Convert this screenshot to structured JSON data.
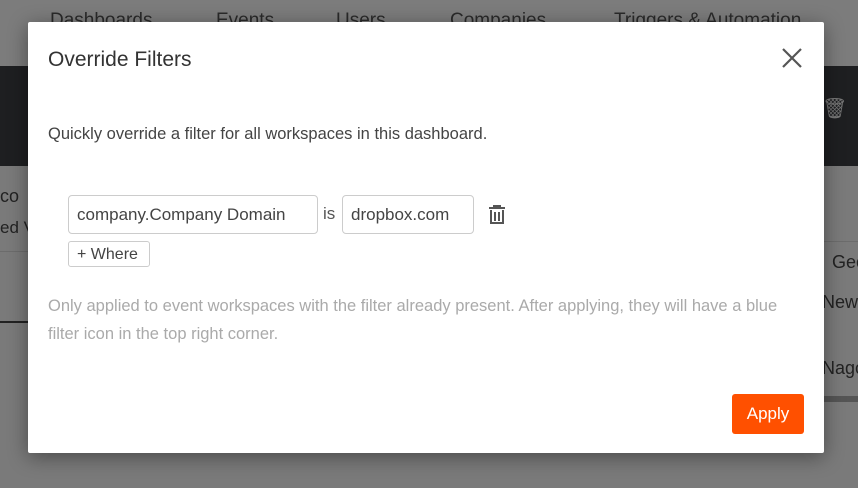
{
  "background": {
    "nav": [
      "Dashboards",
      "Events",
      "Users",
      "Companies",
      "Triggers & Automation"
    ],
    "left_fragments": [
      "co",
      "ed V"
    ],
    "right_fragments": [
      "Geo",
      "New",
      "Nago"
    ]
  },
  "modal": {
    "title": "Override Filters",
    "description": "Quickly override a filter for all workspaces in this dashboard.",
    "filter": {
      "property": "company.Company Domain",
      "operator": "is",
      "value": "dropbox.com"
    },
    "add_where_label": "+ Where",
    "note": "Only applied to event workspaces with the filter already present. After applying, they will have a blue filter icon in the top right corner.",
    "apply_label": "Apply",
    "accent_color": "#ff5000"
  }
}
